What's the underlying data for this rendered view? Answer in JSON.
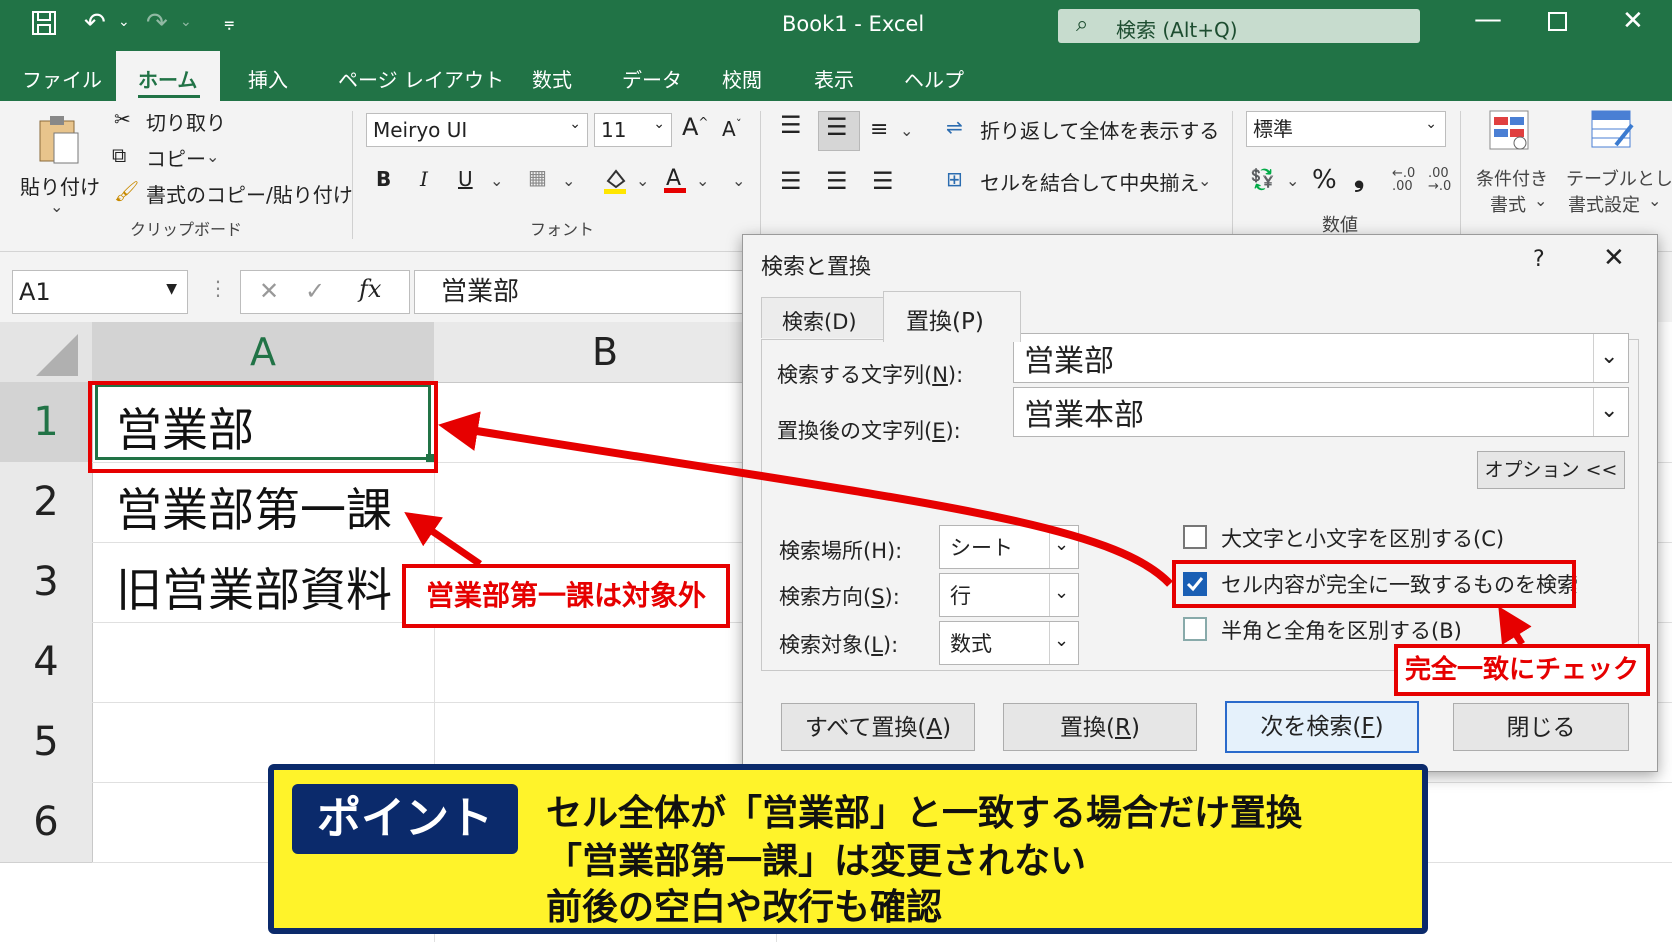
{
  "titlebar": {
    "title": "Book1  -  Excel",
    "search": "検索 (Alt+Q)"
  },
  "menu": [
    "ファイル",
    "ホーム",
    "挿入",
    "ページ レイアウト",
    "数式",
    "データ",
    "校閲",
    "表示",
    "ヘルプ"
  ],
  "ribbon": {
    "paste": "貼り付け",
    "cut": "切り取り",
    "copy": "コピー",
    "format_painter": "書式のコピー/貼り付け",
    "clipboard_group": "クリップボード",
    "font_name": "Meiryo UI",
    "font_size": "11",
    "font_group": "フォント",
    "wrap_text": "折り返して全体を表示する",
    "merge_center": "セルを結合して中央揃え",
    "number_format": "標準",
    "number_group": "数値",
    "conditional_1": "条件付き",
    "conditional_2": "書式",
    "table_1": "テーブルとして",
    "table_2": "書式設定"
  },
  "formula": {
    "name_box": "A1",
    "content": "営業部"
  },
  "grid": {
    "columns": [
      "A",
      "B"
    ],
    "rows": [
      "1",
      "2",
      "3",
      "4",
      "5",
      "6"
    ],
    "cells": [
      "営業部",
      "営業部第一課",
      "旧営業部資料"
    ]
  },
  "dialog": {
    "title": "検索と置換",
    "help": "?",
    "tab_find": "検索(D)",
    "tab_replace": "置換(P)",
    "find_label": "検索する文字列(N):",
    "find_value": "営業部",
    "replace_label": "置換後の文字列(E):",
    "replace_value": "営業本部",
    "options_button": "オプション <<",
    "within_label": "検索場所(H):",
    "within_value": "シート",
    "search_label": "検索方向(S):",
    "search_value": "行",
    "lookin_label": "検索対象(L):",
    "lookin_value": "数式",
    "match_case": {
      "label": "大文字と小文字を区別する(C)",
      "checked": false
    },
    "match_entire": {
      "label": "セル内容が完全に一致するものを検索",
      "checked": true
    },
    "match_width": {
      "label": "半角と全角を区別する(B)",
      "checked": false
    },
    "btn_replace_all": "すべて置換(A)",
    "btn_replace": "置換(R)",
    "btn_find_next": "次を検索(F)",
    "btn_close": "閉じる"
  },
  "annotations": {
    "excluded": "営業部第一課は対象外",
    "check": "完全一致にチェック"
  },
  "callout": {
    "badge": "ポイント",
    "lines": [
      "セル全体が「営業部」と一致する場合だけ置換",
      "「営業部第一課」は変更されない",
      "前後の空白や改行も確認"
    ]
  },
  "colors": {
    "excel_green": "#217346",
    "annotation_red": "#e60000",
    "callout_yellow": "#fff32a",
    "callout_navy": "#0b2a6b"
  }
}
